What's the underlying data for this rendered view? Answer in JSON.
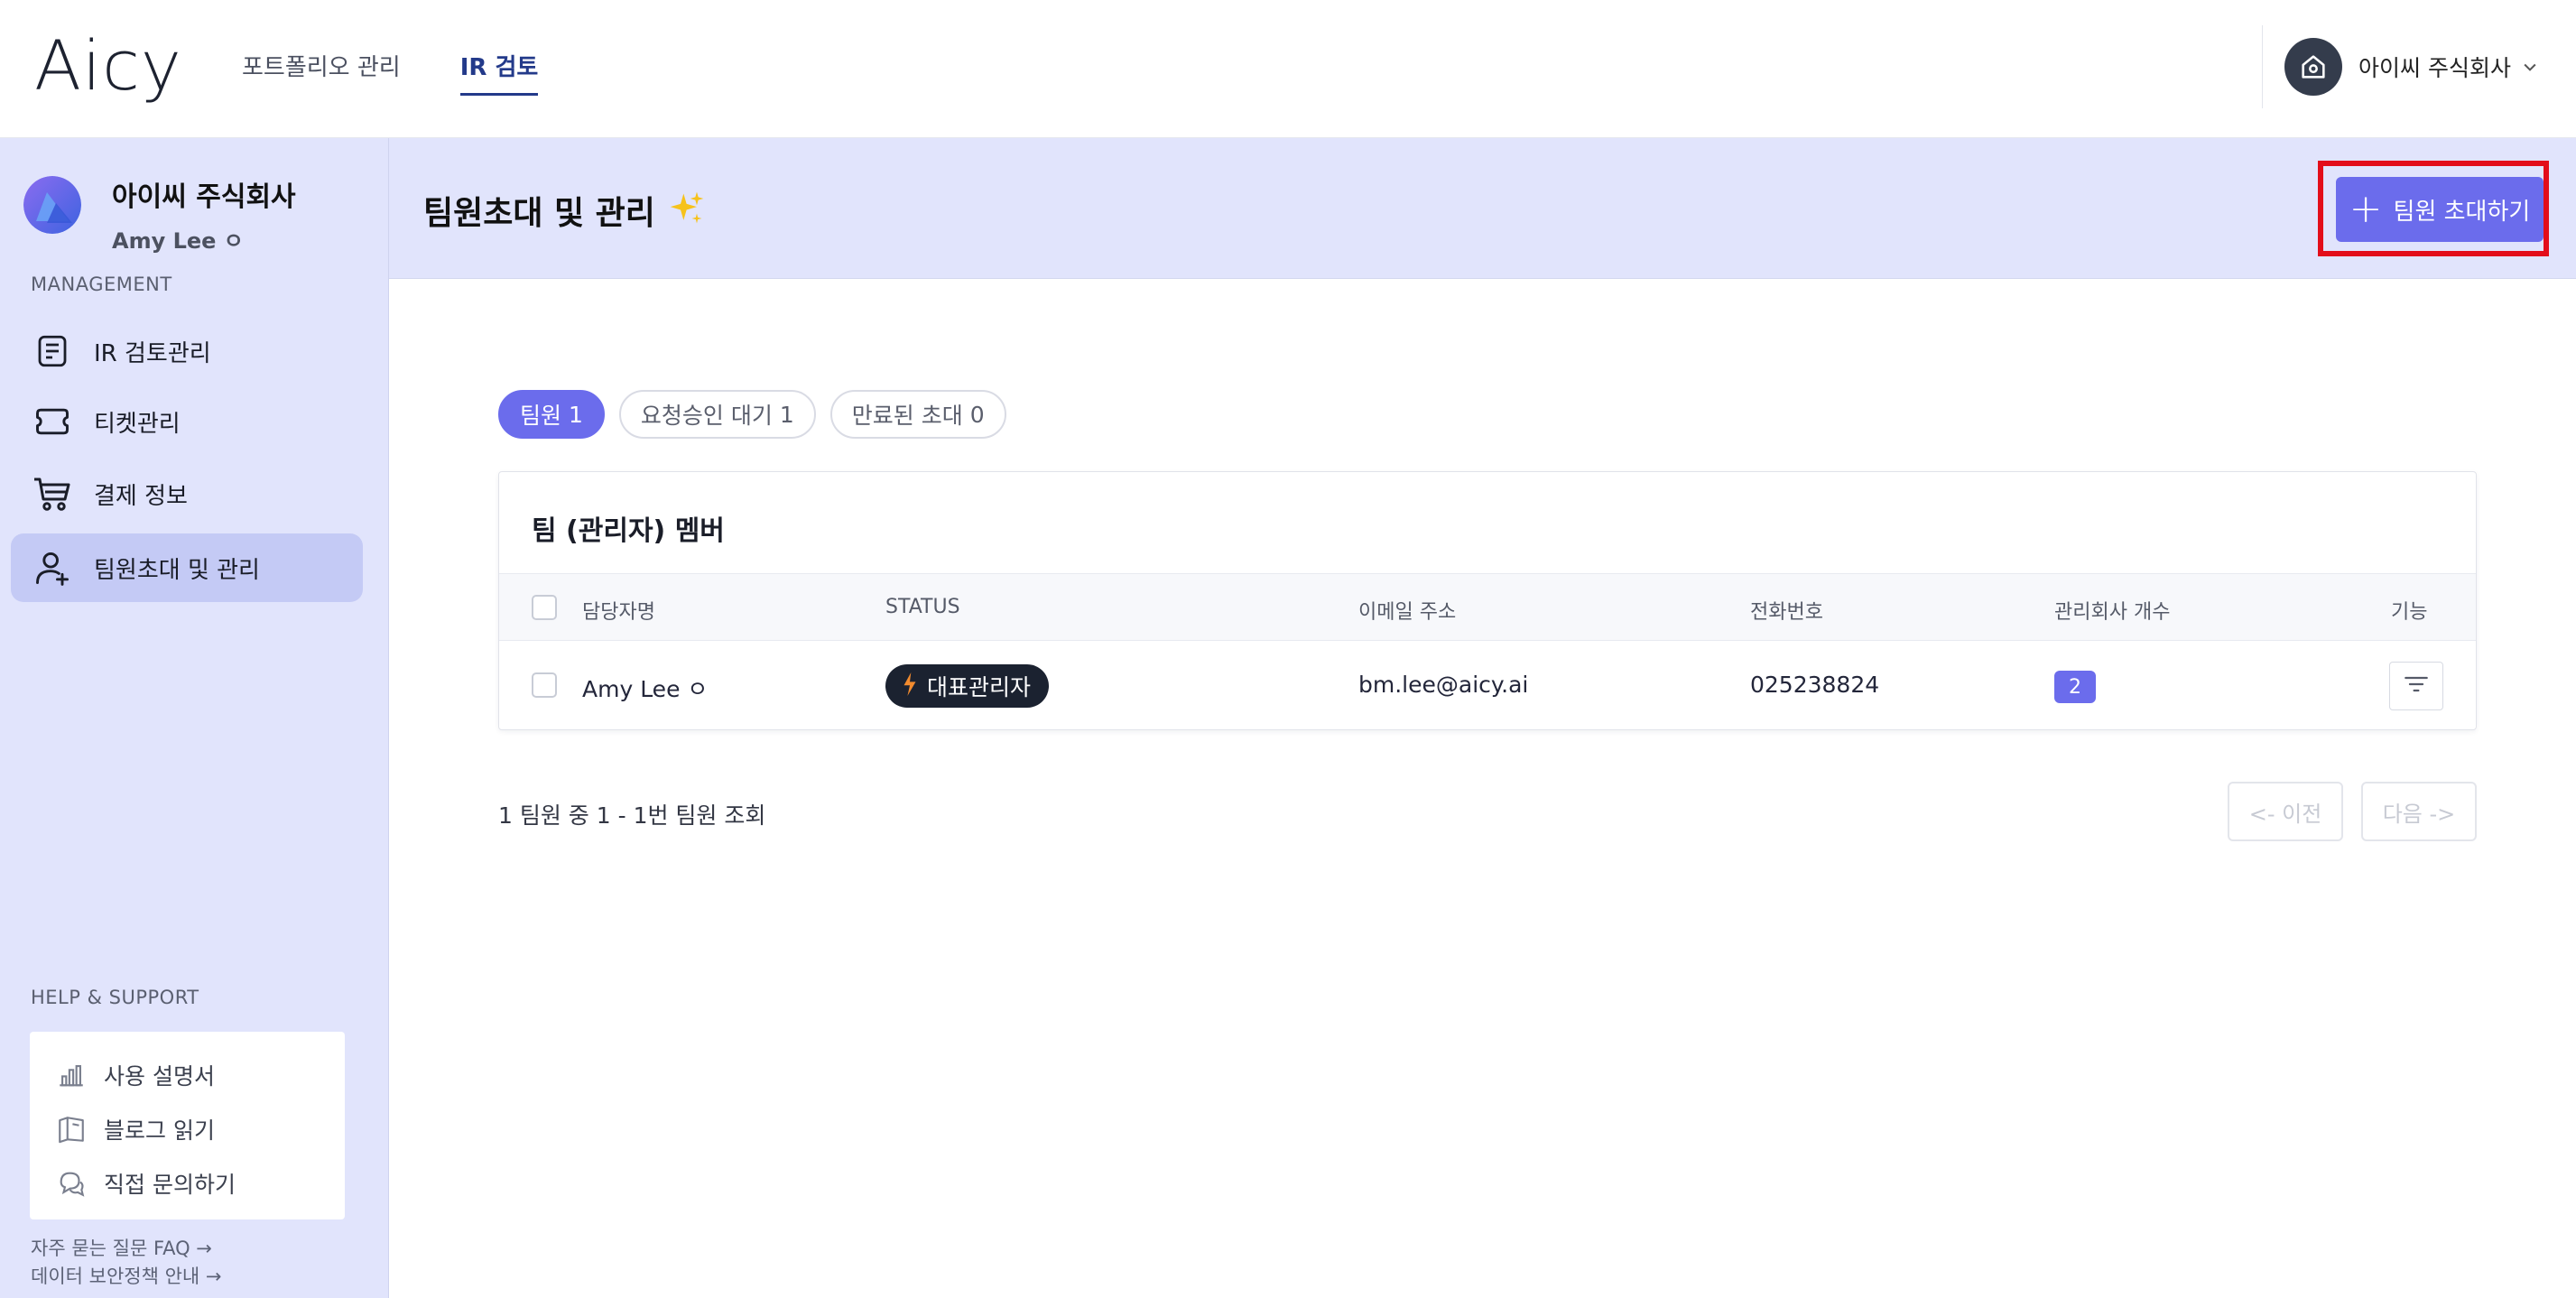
{
  "app": {
    "logo_text": "Aicy"
  },
  "topnav": {
    "items": [
      {
        "label": "포트폴리오 관리"
      },
      {
        "label": "IR 검토"
      }
    ]
  },
  "header": {
    "company_name": "아이씨 주식회사"
  },
  "sidebar": {
    "company_name": "아이씨 주식회사",
    "user_name": "Amy Lee ㅇ",
    "management_label": "MANAGEMENT",
    "items": [
      {
        "label": "IR 검토관리",
        "icon": "document-icon"
      },
      {
        "label": "티켓관리",
        "icon": "ticket-icon"
      },
      {
        "label": "결제 정보",
        "icon": "cart-icon"
      },
      {
        "label": "팀원초대 및 관리",
        "icon": "user-add-icon"
      }
    ],
    "help_label": "HELP & SUPPORT",
    "help_items": [
      {
        "label": "사용 설명서",
        "icon": "chart-bars-icon"
      },
      {
        "label": "블로그 읽기",
        "icon": "book-icon"
      },
      {
        "label": "직접 문의하기",
        "icon": "chat-icon"
      }
    ],
    "faq_link": "자주 묻는 질문 FAQ →",
    "security_link": "데이터 보안정책 안내 →"
  },
  "main": {
    "title": "팀원초대 및 관리",
    "invite_button": "팀원 초대하기",
    "tabs": [
      {
        "label": "팀원",
        "count": "1"
      },
      {
        "label": "요청승인 대기",
        "count": "1"
      },
      {
        "label": "만료된 초대",
        "count": "0"
      }
    ],
    "table": {
      "title": "팀 (관리자) 멤버",
      "columns": [
        "담당자명",
        "STATUS",
        "이메일 주소",
        "전화번호",
        "관리회사 개수",
        "기능"
      ],
      "rows": [
        {
          "name": "Amy Lee ㅇ",
          "status": "대표관리자",
          "email": "bm.lee@aicy.ai",
          "phone": "025238824",
          "company_count": "2"
        }
      ]
    },
    "pagination": {
      "summary": "1 팀원 중 1 - 1번 팀원 조회",
      "prev": "<- 이전",
      "next": "다음 ->"
    }
  },
  "colors": {
    "accent": "#6b6cec",
    "sidebar_bg": "#e1e4fc",
    "highlight": "#e30d1a",
    "badge_dark": "#1b2230"
  }
}
